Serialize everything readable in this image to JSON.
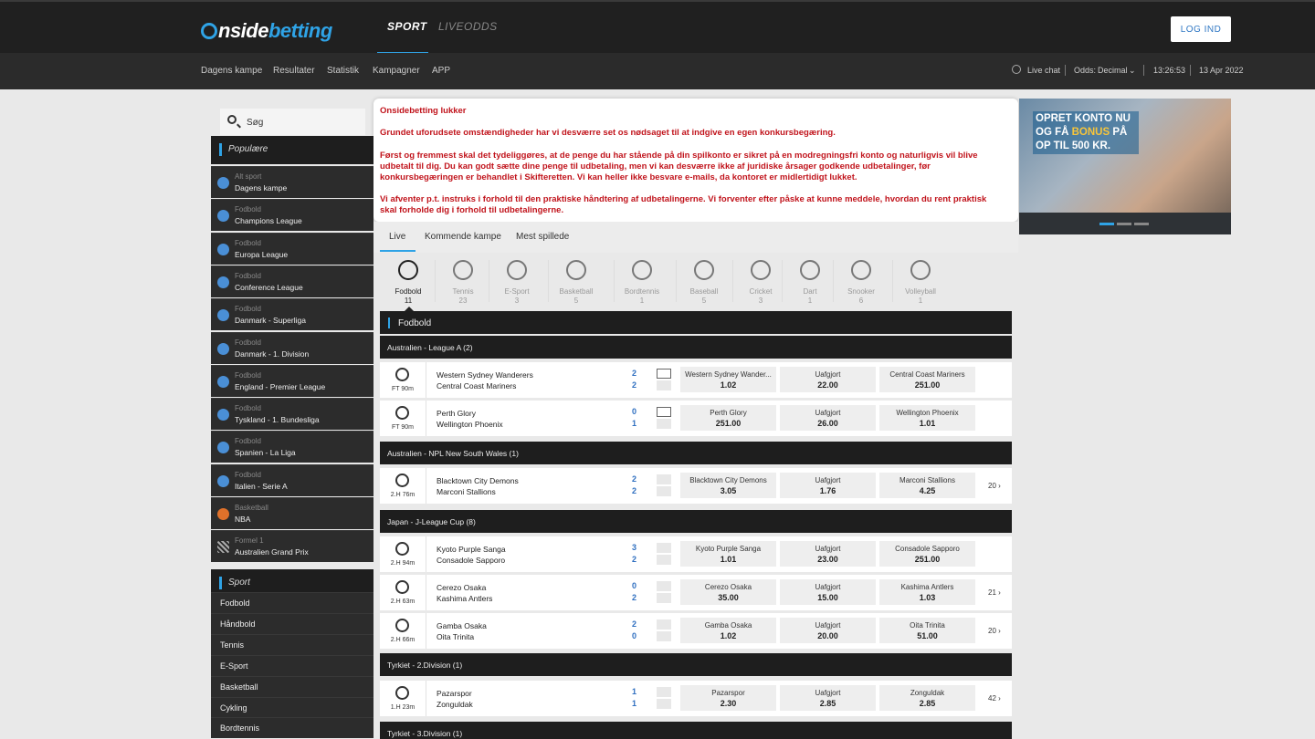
{
  "header": {
    "logo_prefix": "nside",
    "logo_suffix": "betting",
    "tabs": [
      "SPORT",
      "LIVEODDS"
    ],
    "login_label": "LOG IND"
  },
  "subnav": {
    "links": [
      "Dagens kampe",
      "Resultater",
      "Statistik",
      "Kampagner",
      "APP"
    ],
    "live_chat": "Live chat",
    "odds_label": "Odds:",
    "odds_value": "Decimal",
    "clock": "13:26:53",
    "date": "13 Apr 2022"
  },
  "sidebar": {
    "search_placeholder": "Søg",
    "popular_title": "Populære",
    "popular": [
      {
        "sub": "Alt sport",
        "main": "Dagens kampe"
      },
      {
        "sub": "Fodbold",
        "main": "Champions League"
      },
      {
        "sub": "Fodbold",
        "main": "Europa League"
      },
      {
        "sub": "Fodbold",
        "main": "Conference League"
      },
      {
        "sub": "Fodbold",
        "main": "Danmark - Superliga"
      },
      {
        "sub": "Fodbold",
        "main": "Danmark - 1. Division"
      },
      {
        "sub": "Fodbold",
        "main": "England - Premier League"
      },
      {
        "sub": "Fodbold",
        "main": "Tyskland - 1. Bundesliga"
      },
      {
        "sub": "Fodbold",
        "main": "Spanien - La Liga"
      },
      {
        "sub": "Fodbold",
        "main": "Italien - Serie A"
      },
      {
        "sub": "Basketball",
        "main": "NBA"
      },
      {
        "sub": "Formel 1",
        "main": "Australien Grand Prix"
      }
    ],
    "sport_title": "Sport",
    "sports": [
      "Fodbold",
      "Håndbold",
      "Tennis",
      "E-Sport",
      "Basketball",
      "Cykling",
      "Bordtennis"
    ]
  },
  "notice": {
    "title": "Onsidebetting lukker",
    "p1": "Grundet uforudsete omstændigheder har vi desværre set os nødsaget til at indgive en egen konkursbegæring.",
    "p2a": "Først og fremmest skal det tydeliggøres, at de penge du har stående på din spilkonto er sikret på en modregningsfri konto og naturligvis vil blive",
    "p2b": "udbetalt til dig. Du kan godt sætte dine penge til udbetaling, men vi kan desværre ikke af juridiske årsager godkende udbetalinger, før",
    "p2c": "konkursbegæringen er behandlet i Skifteretten. Vi kan heller ikke besvare e-mails, da kontoret er midlertidigt lukket.",
    "p3a": "Vi afventer p.t. instruks i forhold til den praktiske håndtering af udbetalingerne. Vi forventer efter påske at kunne meddele, hvordan du rent praktisk",
    "p3b": "skal forholde dig i forhold til udbetalingerne."
  },
  "banner": {
    "line1": "OPRET KONTO NU",
    "line2a": "OG FÅ ",
    "line2b": "BONUS",
    "line2c": " PÅ",
    "line3": "OP TIL 500 KR."
  },
  "tabs": [
    "Live",
    "Kommende kampe",
    "Mest spillede"
  ],
  "sports_row": [
    {
      "label": "Fodbold",
      "count": "11"
    },
    {
      "label": "Tennis",
      "count": "23"
    },
    {
      "label": "E-Sport",
      "count": "3"
    },
    {
      "label": "Basketball",
      "count": "5"
    },
    {
      "label": "Bordtennis",
      "count": "1"
    },
    {
      "label": "Baseball",
      "count": "5"
    },
    {
      "label": "Cricket",
      "count": "3"
    },
    {
      "label": "Dart",
      "count": "1"
    },
    {
      "label": "Snooker",
      "count": "6"
    },
    {
      "label": "Volleyball",
      "count": "1"
    }
  ],
  "list_title": "Fodbold",
  "leagues": [
    "Australien - League A (2)",
    "Australien - NPL New South Wales (1)",
    "Japan - J-League Cup (8)",
    "Tyrkiet - 2.Division (1)",
    "Tyrkiet - 3.Division (1)"
  ],
  "matches": [
    {
      "time": "FT 90m",
      "home": "Western Sydney Wanderers",
      "away": "Central Coast Mariners",
      "sh": "2",
      "sa": "2",
      "o1n": "Western Sydney Wander...",
      "o1": "1.02",
      "o2n": "Uafgjort",
      "o2": "22.00",
      "o3n": "Central Coast Mariners",
      "o3": "251.00",
      "more": ""
    },
    {
      "time": "FT 90m",
      "home": "Perth Glory",
      "away": "Wellington Phoenix",
      "sh": "0",
      "sa": "1",
      "o1n": "Perth Glory",
      "o1": "251.00",
      "o2n": "Uafgjort",
      "o2": "26.00",
      "o3n": "Wellington Phoenix",
      "o3": "1.01",
      "more": ""
    },
    {
      "time": "2.H 76m",
      "home": "Blacktown City Demons",
      "away": "Marconi Stallions",
      "sh": "2",
      "sa": "2",
      "o1n": "Blacktown City Demons",
      "o1": "3.05",
      "o2n": "Uafgjort",
      "o2": "1.76",
      "o3n": "Marconi Stallions",
      "o3": "4.25",
      "more": "20 ›"
    },
    {
      "time": "2.H 94m",
      "home": "Kyoto Purple Sanga",
      "away": "Consadole Sapporo",
      "sh": "3",
      "sa": "2",
      "o1n": "Kyoto Purple Sanga",
      "o1": "1.01",
      "o2n": "Uafgjort",
      "o2": "23.00",
      "o3n": "Consadole Sapporo",
      "o3": "251.00",
      "more": ""
    },
    {
      "time": "2.H 63m",
      "home": "Cerezo Osaka",
      "away": "Kashima Antlers",
      "sh": "0",
      "sa": "2",
      "o1n": "Cerezo Osaka",
      "o1": "35.00",
      "o2n": "Uafgjort",
      "o2": "15.00",
      "o3n": "Kashima Antlers",
      "o3": "1.03",
      "more": "21 ›"
    },
    {
      "time": "2.H 66m",
      "home": "Gamba Osaka",
      "away": "Oita Trinita",
      "sh": "2",
      "sa": "0",
      "o1n": "Gamba Osaka",
      "o1": "1.02",
      "o2n": "Uafgjort",
      "o2": "20.00",
      "o3n": "Oita Trinita",
      "o3": "51.00",
      "more": "20 ›"
    },
    {
      "time": "1.H 23m",
      "home": "Pazarspor",
      "away": "Zonguldak",
      "sh": "1",
      "sa": "1",
      "o1n": "Pazarspor",
      "o1": "2.30",
      "o2n": "Uafgjort",
      "o2": "2.85",
      "o3n": "Zonguldak",
      "o3": "2.85",
      "more": "42 ›"
    }
  ]
}
